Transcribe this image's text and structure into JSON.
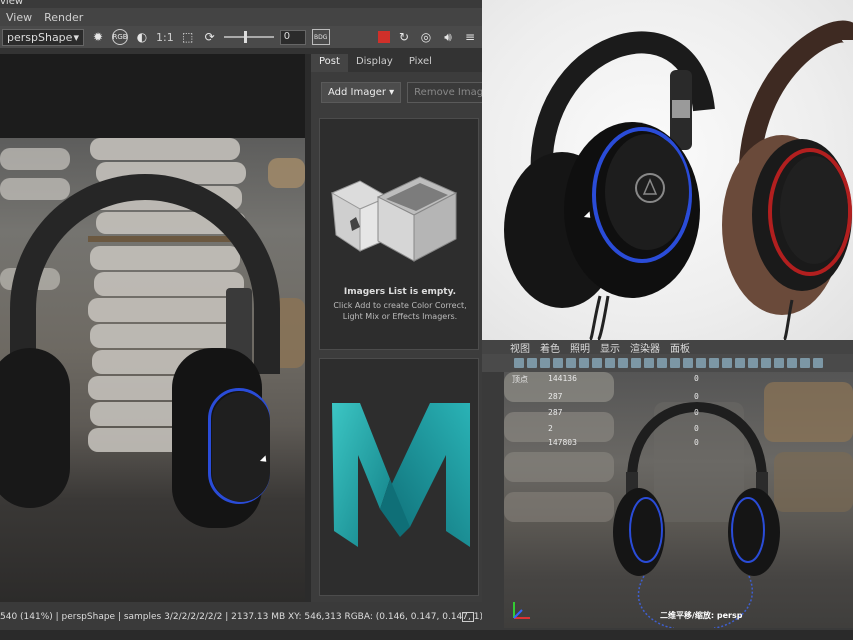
{
  "window": {
    "title_fragment": "view"
  },
  "menu": {
    "items": [
      "View",
      "Render"
    ]
  },
  "toolbar": {
    "camera": "perspShape",
    "ratio_label": "1:1",
    "exposure_value": "0",
    "badge": "BDG"
  },
  "post_panel": {
    "tabs": [
      "Post",
      "Display",
      "Pixel"
    ],
    "add_imager": "Add Imager",
    "remove_imager": "Remove Imager",
    "empty_title": "Imagers List is empty.",
    "empty_text": "Click Add to create Color Correct, Light Mix or Effects Imagers."
  },
  "status": {
    "text": "540 (141%) | perspShape  | samples 3/2/2/2/2/2/2 | 2137.13 MB XY: 546,313   RGBA: (0.146, 0.147, 0.147, 1)"
  },
  "viewport": {
    "menu": [
      "视图",
      "着色",
      "照明",
      "显示",
      "渲染器",
      "面板"
    ],
    "hud_rows": [
      {
        "label": "顶点",
        "value": "144136",
        "extra": "0"
      },
      {
        "label": "",
        "value": "287",
        "extra": "0"
      },
      {
        "label": "",
        "value": "287",
        "extra": "0"
      },
      {
        "label": "",
        "value": "2",
        "extra": "0"
      },
      {
        "label": "",
        "value": "147803",
        "extra": "0"
      }
    ],
    "camera_label": "二维平移/缩放: persp"
  },
  "colors": {
    "accent_blue": "#2a4cd8",
    "stop_red": "#d0302a",
    "logo_teal": "#1fa6a8"
  }
}
